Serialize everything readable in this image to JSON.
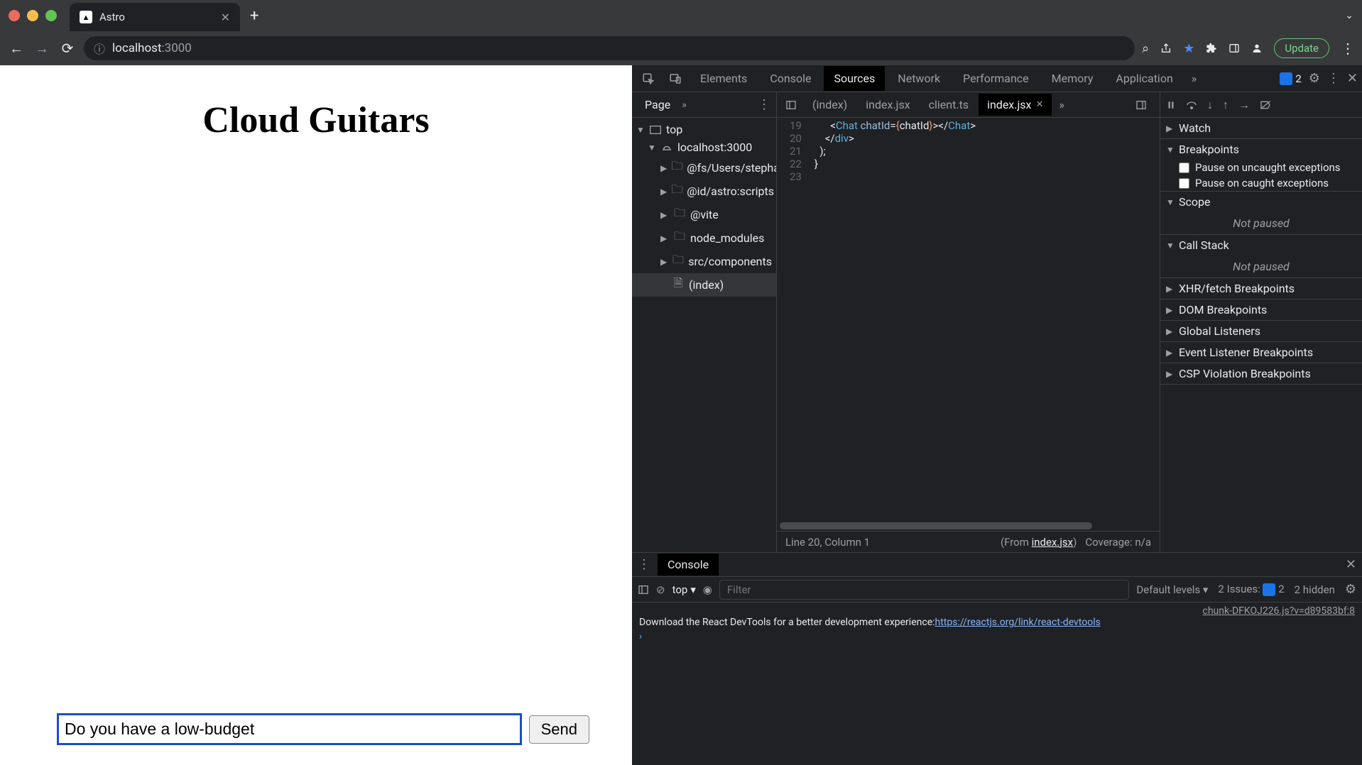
{
  "browser": {
    "tab_title": "Astro",
    "url_host": "localhost",
    "url_port": ":3000",
    "update_label": "Update"
  },
  "page": {
    "heading": "Cloud Guitars",
    "chat_input_value": "Do you have a low-budget",
    "send_label": "Send"
  },
  "devtools": {
    "tabs": [
      "Elements",
      "Console",
      "Sources",
      "Network",
      "Performance",
      "Memory",
      "Application"
    ],
    "active_tab": "Sources",
    "issues_count": "2",
    "navigator": {
      "subtab": "Page",
      "tree": {
        "top": "top",
        "host": "localhost:3000",
        "folders": [
          "@fs/Users/stepha",
          "@id/astro:scripts",
          "@vite",
          "node_modules",
          "src/components"
        ],
        "file": "(index)"
      }
    },
    "editor": {
      "tabs": [
        "(index)",
        "index.jsx",
        "client.ts",
        "index.jsx"
      ],
      "active_tab_index": 3,
      "line_start": 19,
      "code_lines": [
        {
          "n": 19,
          "html": "      <span class='tok-punct'>&lt;</span><span class='tok-tag'>Chat</span> <span class='tok-attr'>chatId</span><span class='tok-punct'>=</span><span class='tok-brace'>{</span><span class='tok-val'>chatId</span><span class='tok-brace'>}</span><span class='tok-punct'>&gt;&lt;/</span><span class='tok-tag'>Chat</span><span class='tok-punct'>&gt;</span>"
        },
        {
          "n": 20,
          "html": "    <span class='tok-punct'>&lt;/</span><span class='tok-tag'>div</span><span class='tok-punct'>&gt;</span>"
        },
        {
          "n": 21,
          "html": "  <span class='tok-punct'>);</span>"
        },
        {
          "n": 22,
          "html": "<span class='tok-punct'>}</span>"
        },
        {
          "n": 23,
          "html": ""
        }
      ],
      "status_line": "Line 20, Column 1",
      "status_from": "(From ",
      "status_file": "index.jsx",
      "status_close": ")",
      "coverage": "Coverage: n/a"
    },
    "debugger": {
      "sections": {
        "watch": "Watch",
        "breakpoints": "Breakpoints",
        "pause_uncaught": "Pause on uncaught exceptions",
        "pause_caught": "Pause on caught exceptions",
        "scope": "Scope",
        "scope_state": "Not paused",
        "callstack": "Call Stack",
        "callstack_state": "Not paused",
        "xhr": "XHR/fetch Breakpoints",
        "dom": "DOM Breakpoints",
        "global": "Global Listeners",
        "event": "Event Listener Breakpoints",
        "csp": "CSP Violation Breakpoints"
      }
    },
    "console": {
      "tab": "Console",
      "context": "top",
      "filter_placeholder": "Filter",
      "levels": "Default levels",
      "issues_label": "2 Issues:",
      "issues_count": "2",
      "hidden": "2 hidden",
      "source_link": "chunk-DFKOJ226.js?v=d89583bf:8",
      "message": "Download the React DevTools for a better development experience: ",
      "message_link": "https://reactjs.org/link/react-devtools"
    }
  }
}
